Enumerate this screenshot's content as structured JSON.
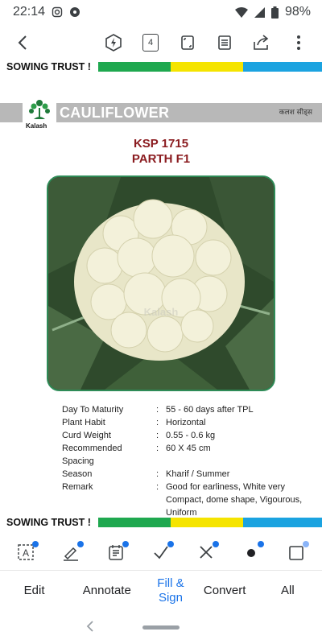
{
  "status_bar": {
    "time": "22:14",
    "battery": "98%"
  },
  "toolbar": {
    "page_count": "4"
  },
  "document": {
    "slogan": "SOWING TRUST !",
    "brand": "Kalash",
    "crop": "CAULIFLOWER",
    "header_right": "कलश सीड्स",
    "variety_code": "KSP 1715",
    "variety_name": "PARTH F1",
    "watermark": "Kalash",
    "colors": {
      "green": "#1fa84f",
      "yellow": "#f5e400",
      "blue": "#1ba3e0",
      "title_red": "#8b1c20",
      "header_gray": "#b8b8b8"
    },
    "specs": [
      {
        "label": "Day To Maturity",
        "value": "55 - 60 days after TPL"
      },
      {
        "label": "Plant Habit",
        "value": "Horizontal"
      },
      {
        "label": "Curd Weight",
        "value": "0.55 - 0.6 kg"
      },
      {
        "label": "Recommended Spacing",
        "value": "60 X 45 cm"
      },
      {
        "label": "Season",
        "value": "Kharif / Summer"
      },
      {
        "label": "Remark",
        "value": "Good for earliness, White very"
      },
      {
        "label": "",
        "value": "Compact, dome shape, Vigourous,"
      },
      {
        "label": "",
        "value": "Uniform"
      }
    ]
  },
  "bottom_tabs": [
    {
      "label": "Edit",
      "active": false
    },
    {
      "label": "Annotate",
      "active": false
    },
    {
      "label": "Fill & Sign",
      "active": true
    },
    {
      "label": "Convert",
      "active": false
    },
    {
      "label": "All",
      "active": false
    }
  ],
  "tool_icons": [
    "text-box-icon",
    "pen-sign-icon",
    "form-icon",
    "checkmark-icon",
    "cross-icon",
    "dot-icon",
    "square-icon"
  ]
}
